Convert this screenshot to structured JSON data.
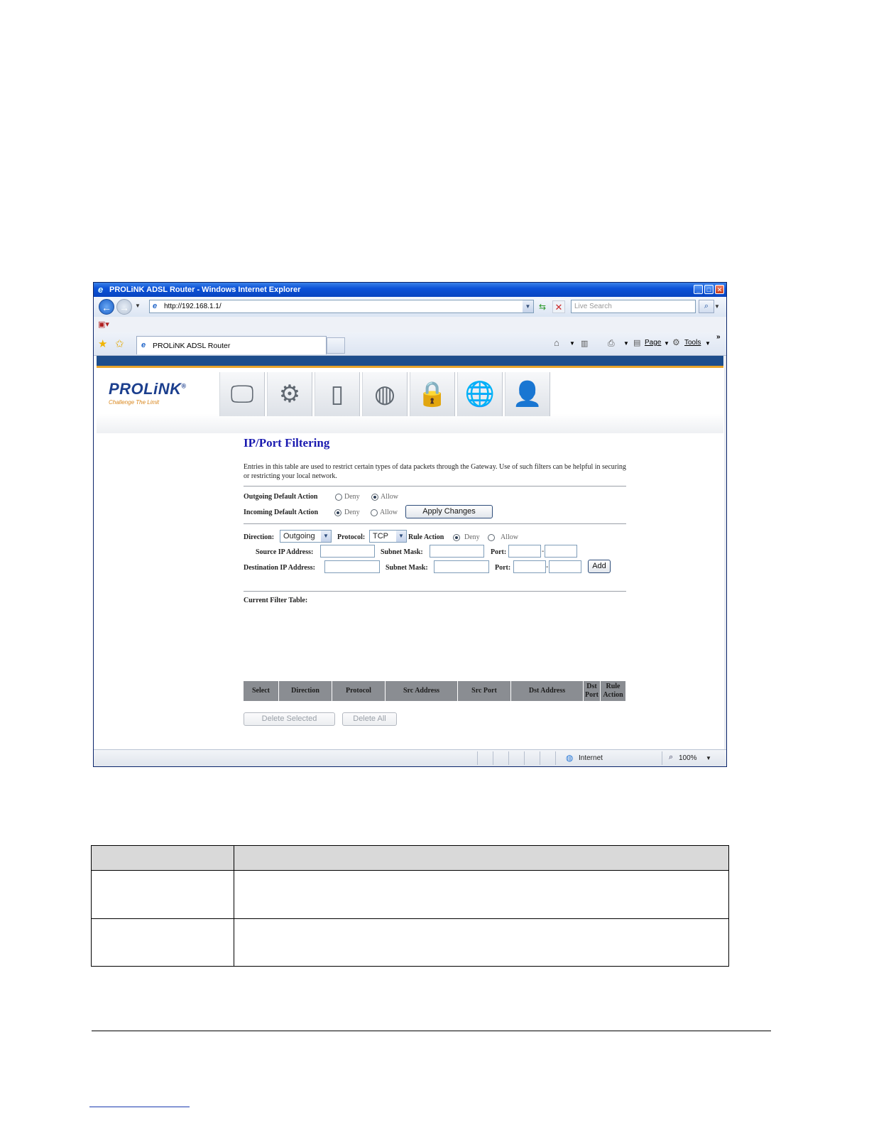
{
  "browser": {
    "window_title": "PROLiNK ADSL Router - Windows Internet Explorer",
    "address": "http://192.168.1.1/",
    "search_placeholder": "Live Search",
    "tab_label": "PROLiNK ADSL Router",
    "commands": {
      "page": "Page",
      "tools": "Tools"
    },
    "status": {
      "zone": "Internet",
      "zoom": "100%"
    }
  },
  "router": {
    "logo": "PROLiNK",
    "logo_mark": "®",
    "tagline": "Challenge The Limit",
    "nav_icons": [
      "monitor-icon",
      "gear-icon",
      "server-icon",
      "globe-icon",
      "lock-icon",
      "network-icon",
      "user-icon"
    ],
    "title": "IP/Port Filtering",
    "description": "Entries in this table are used to restrict certain types of data packets through the Gateway. Use of such filters can be helpful in securing or restricting your local network.",
    "outgoing": {
      "label": "Outgoing Default Action",
      "deny": "Deny",
      "allow": "Allow",
      "selected": "Allow"
    },
    "incoming": {
      "label": "Incoming Default Action",
      "deny": "Deny",
      "allow": "Allow",
      "selected": "Deny"
    },
    "apply_label": "Apply Changes",
    "rule": {
      "direction_label": "Direction:",
      "direction_value": "Outgoing",
      "protocol_label": "Protocol:",
      "protocol_value": "TCP",
      "action_label": "Rule Action",
      "deny": "Deny",
      "allow": "Allow",
      "action_selected": "Deny",
      "src_ip_label": "Source IP Address:",
      "src_mask_label": "Subnet Mask:",
      "src_port_label": "Port:",
      "dst_ip_label": "Destination IP Address:",
      "dst_mask_label": "Subnet Mask:",
      "dst_port_label": "Port:",
      "add_label": "Add"
    },
    "table_title": "Current Filter Table:",
    "columns": [
      "Select",
      "Direction",
      "Protocol",
      "Src Address",
      "Src Port",
      "Dst Address",
      "Dst Port",
      "Rule Action"
    ],
    "delete_selected": "Delete Selected",
    "delete_all": "Delete All"
  },
  "colors": {
    "title_blue": "#1a1ab0",
    "header_bar": "#1d4d8c",
    "accent_orange": "#e8a32a"
  }
}
